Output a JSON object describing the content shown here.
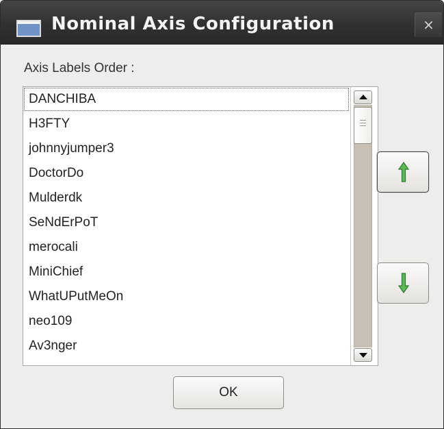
{
  "window": {
    "title": "Nominal Axis Configuration",
    "close_glyph": "×"
  },
  "axis_labels": {
    "label": "Axis Labels Order :",
    "items": [
      "DANCHIBA",
      "H3FTY",
      "johnnyjumper3",
      "DoctorDo",
      "Mulderdk",
      "SeNdErPoT",
      "merocali",
      "MiniChief",
      "WhatUPutMeOn",
      "neo109",
      "Av3nger"
    ],
    "selected_item": "DANCHIBA"
  },
  "buttons": {
    "move_up_icon": "arrow-up-icon",
    "move_down_icon": "arrow-down-icon",
    "ok_label": "OK"
  },
  "colors": {
    "title_bar": "#313131",
    "arrow_green": "#3f9a3a",
    "dialog_background": "#ededeb"
  }
}
